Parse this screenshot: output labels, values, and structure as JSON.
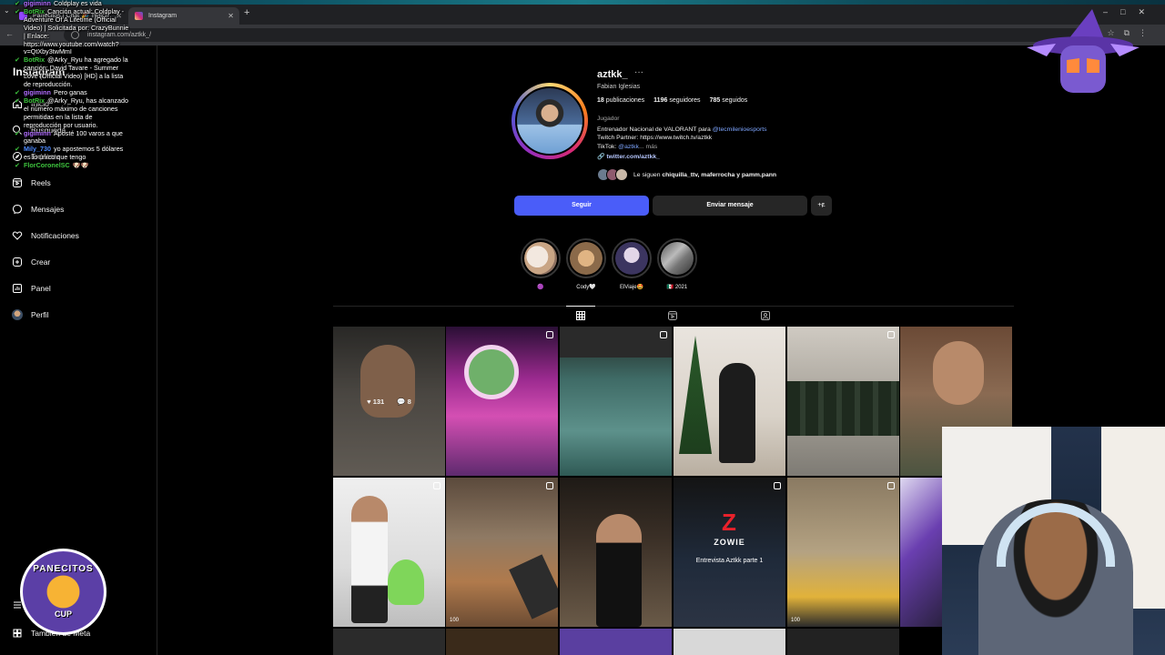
{
  "browser": {
    "tabs": [
      {
        "title": "Panecitos | Chat 🎉 Twitch",
        "active": false
      },
      {
        "title": "Instagram",
        "active": true
      }
    ],
    "url": "instagram.com/aztkk_/"
  },
  "sidebar": {
    "logo": "Instagram",
    "items": [
      {
        "label": "Inicio",
        "icon": "home-icon"
      },
      {
        "label": "Búsqueda",
        "icon": "search-icon"
      },
      {
        "label": "Explorar",
        "icon": "compass-icon"
      },
      {
        "label": "Reels",
        "icon": "reels-icon"
      },
      {
        "label": "Mensajes",
        "icon": "messenger-icon"
      },
      {
        "label": "Notificaciones",
        "icon": "heart-icon"
      },
      {
        "label": "Crear",
        "icon": "plus-square-icon"
      },
      {
        "label": "Panel",
        "icon": "dashboard-icon"
      },
      {
        "label": "Perfil",
        "icon": "avatar"
      }
    ],
    "more": "También de Meta"
  },
  "chat": [
    {
      "user": "gigiminn",
      "color": "#b06cff",
      "text": "Coldplay es vida"
    },
    {
      "user": "BotRix",
      "color": "#3ec43e",
      "text": "Canción actual: Coldplay - Adventure Of A Lifetime (Official Video) | Solicitada por: CrazyBunnie | Enlace: https://www.youtube.com/watch?v=QtXby3twMmI"
    },
    {
      "user": "BotRix",
      "color": "#3ec43e",
      "text": "@Arky_Ryu ha agregado la canción: David Tavare - Summer Love (Official Video) [HD] a la lista de reproducción."
    },
    {
      "user": "gigiminn",
      "color": "#b06cff",
      "text": "Pero ganas"
    },
    {
      "user": "BotRix",
      "color": "#3ec43e",
      "text": "@Arky_Ryu, has alcanzado el número máximo de canciones permitidas en la lista de reproducción por usuario."
    },
    {
      "user": "gigiminn",
      "color": "#b06cff",
      "text": "Aposté 100 varos a que ganaba"
    },
    {
      "user": "Mily_730",
      "color": "#4f8cff",
      "text": "yo apostemos 5 dólares es lo único que tengo"
    },
    {
      "user": "FlorCoronelSC",
      "color": "#3ec43e",
      "text": "🐶🐶"
    }
  ],
  "profile": {
    "username": "aztkk_",
    "full_name": "Fabian Iglesias",
    "posts": "18",
    "posts_label": "publicaciones",
    "followers": "1196",
    "followers_label": "seguidores",
    "following": "785",
    "following_label": "seguidos",
    "category": "Jugador",
    "bio_line1_prefix": "Entrenador Nacional de VALORANT para ",
    "bio_line1_mention": "@tecmilenioesports",
    "bio_line2": "Twitch Partner: https://www.twitch.tv/aztkk",
    "bio_line3_prefix": "TikTok: ",
    "bio_line3_mention": "@aztkk",
    "bio_line3_suffix": "... más",
    "external_link": "twitter.com/aztkk_",
    "followed_by_prefix": "Le siguen ",
    "followed_by_names": "chiquilla_ttv, maferrocha y pamm.pann"
  },
  "buttons": {
    "follow": "Seguir",
    "message": "Enviar mensaje",
    "suggest": "+ዬ"
  },
  "highlights": [
    {
      "label": "🟣"
    },
    {
      "label": "Cody🤍"
    },
    {
      "label": "ElViaje🤩"
    },
    {
      "label": "🇲🇽 2021"
    }
  ],
  "grid": {
    "hover_likes": "131",
    "hover_comments": "8",
    "zowie_brand": "ZOWIE",
    "zowie_caption": "Entrevista Aztkk parte 1",
    "reel_views": "100"
  },
  "stream_badge": {
    "top": "PANECITOS",
    "bottom": "CUP"
  },
  "colors": {
    "follow_button": "#4a5df9",
    "accent_link": "#7ea6ff"
  }
}
